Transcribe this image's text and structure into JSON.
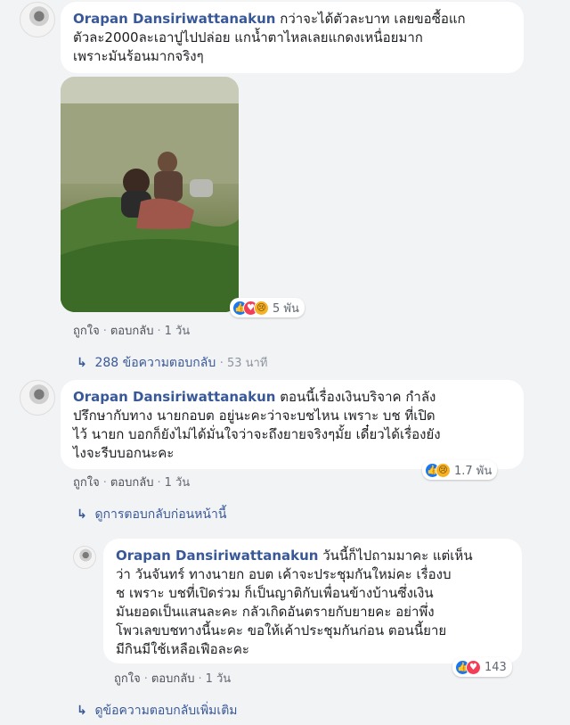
{
  "comments": [
    {
      "author": "Orapan Dansiriwattanakun",
      "lines": [
        "กว่าจะได้ตัวละบาท เลยขอซื้อแก",
        "ตัวละ2000ละเอาปูไปปล่อย แกน้ำตาไหลเลยแกดงเหนื่อยมาก",
        "เพราะมันร้อนมากจริงๆ"
      ],
      "reaction_count": "5 พัน",
      "actions": {
        "like": "ถูกใจ",
        "reply": "ตอบกลับ",
        "time": "1 วัน"
      },
      "replies_link": {
        "text": "288 ข้อความตอบกลับ",
        "time": "53 นาที"
      }
    },
    {
      "author": "Orapan Dansiriwattanakun",
      "lines": [
        "ตอนนี้เรื่องเงินบริจาค กำลัง",
        "ปรึกษากับทาง นายกอบต อยู่นะคะว่าจะบชไหน เพราะ บช ที่เปิด",
        "ไว้ นายก บอกก็ยังไม่ได้มั่นใจว่าจะถึงยายจริงๆมั้ย เดี๋ยวได้เรื่องยัง",
        "ไงจะรีบบอกนะคะ"
      ],
      "reaction_count": "1.7 พัน",
      "actions": {
        "like": "ถูกใจ",
        "reply": "ตอบกลับ",
        "time": "1 วัน"
      },
      "prev_replies_link": "ดูการตอบกลับก่อนหน้านี้"
    },
    {
      "author": "Orapan Dansiriwattanakun",
      "lines": [
        "วันนี้ก็ไปถามมาคะ แต่เห็น",
        "ว่า วันจันทร์ ทางนายก อบต เค้าจะประชุมกันใหม่คะ เรื่องบ",
        "ช เพราะ บชที่เปิดร่วม ก็เป็นญาติกับเพื่อนข้างบ้านซึ่งเงิน",
        "มันยอดเป็นแสนละคะ กลัวเกิดอันตรายกับยายคะ อย่าพึ่ง",
        "โพวเลขบชทางนี้นะคะ ขอให้เค้าประชุมกันก่อน ตอนนี้ยาย",
        "มีกินมีใช้เหลือเฟือละคะ"
      ],
      "reaction_count": "143",
      "actions": {
        "like": "ถูกใจ",
        "reply": "ตอบกลับ",
        "time": "1 วัน"
      }
    }
  ],
  "more_replies_link": "ดูข้อความตอบกลับเพิ่มเติม",
  "icons": {
    "reply_arrow": "↳",
    "like": "👍",
    "love": "♥",
    "sad": "😢"
  },
  "colors": {
    "author": "#385898",
    "background": "#f2f3f5",
    "bubble": "#ffffff"
  }
}
